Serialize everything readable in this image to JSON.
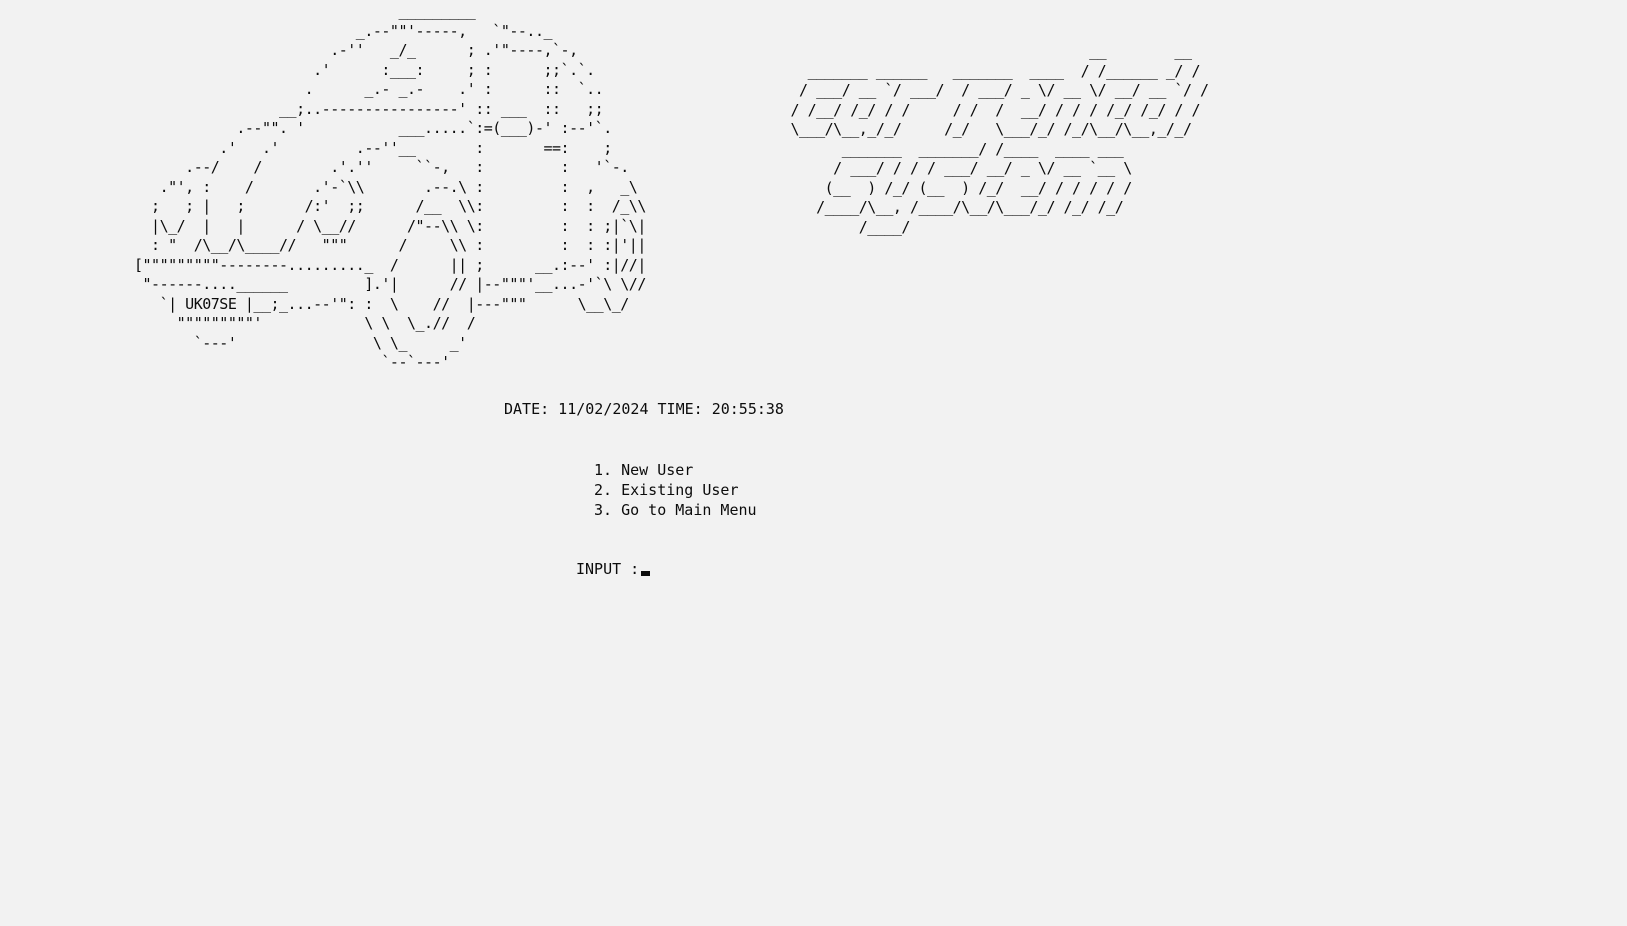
{
  "ascii": {
    "car": "                               _________\n                          _.--\"\"'-----,   `\"--.._\n                       .-''   _/_      ; .'\"----,`-,\n                     .'      :___:     ; :      ;;`.`.\n                    .      _.- _.-    .' :      ::  `..\n                 __;..----------------' :: ___  ::   ;;\n            .--\"\". '           ___.....`:=(___)-' :--'`.\n          .'   .'         .--''__       :       ==:    ;\n      .--/    /        .'.''     ``-,   :         :   '`-.\n   .\"', :    /       .'-`\\\\       .--.\\ :         :  ,   _\\\n  ;   ; |   ;       /:'  ;;      /__  \\\\:         :  :  /_\\\\\n  |\\_/  |   |      / \\__//      /\"--\\\\ \\:         :  : ;|`\\|\n  : \"  /\\__/\\____//   \"\"\"      /     \\\\ :         :  : :|'||\n[\"\"\"\"\"\"\"\"\"--------........._  /      || ;      __.:--' :|//|\n \"------....______         ].'|      // |--\"\"\"'__...-'`\\ \\//\n   `| UK07SE |__;_...--'\": :  \\    //  |---\"\"\"      \\__\\_/\n     \"\"\"\"\"\"\"\"\"'            \\ \\  \\_.//  /\n       `---'                \\ \\_     _'\n                             `--`---'",
    "title": "                                    __        __\n   _______ ______   _______  ____  / /______ _/ /\n  / ___/ __ `/ ___/  / ___/ _ \\/ __ \\/ __/ __ `/ /\n / /__/ /_/ / /     / /  /  __/ / / / /_/ /_/ / /\n \\___/\\__,_/_/     /_/   \\___/_/ /_/\\__/\\__,_/_/\n       _______  _______/ /____  ____ ___\n      / ___/ / / / ___/ __/ _ \\/ __ `__ \\\n     (__  ) /_/ (__  ) /_/  __/ / / / / /\n    /____/\\__, /____/\\__/\\___/_/ /_/ /_/\n         /____/"
  },
  "datetime": {
    "text": "DATE: 11/02/2024 TIME: 20:55:38"
  },
  "menu": {
    "items": [
      {
        "label": "1. New User"
      },
      {
        "label": "2. Existing User"
      },
      {
        "label": "3. Go to Main Menu"
      }
    ]
  },
  "prompt": {
    "label": "INPUT :",
    "value": ""
  },
  "colors": {
    "background": "#f2f2f2",
    "text": "#0c0c0c"
  }
}
